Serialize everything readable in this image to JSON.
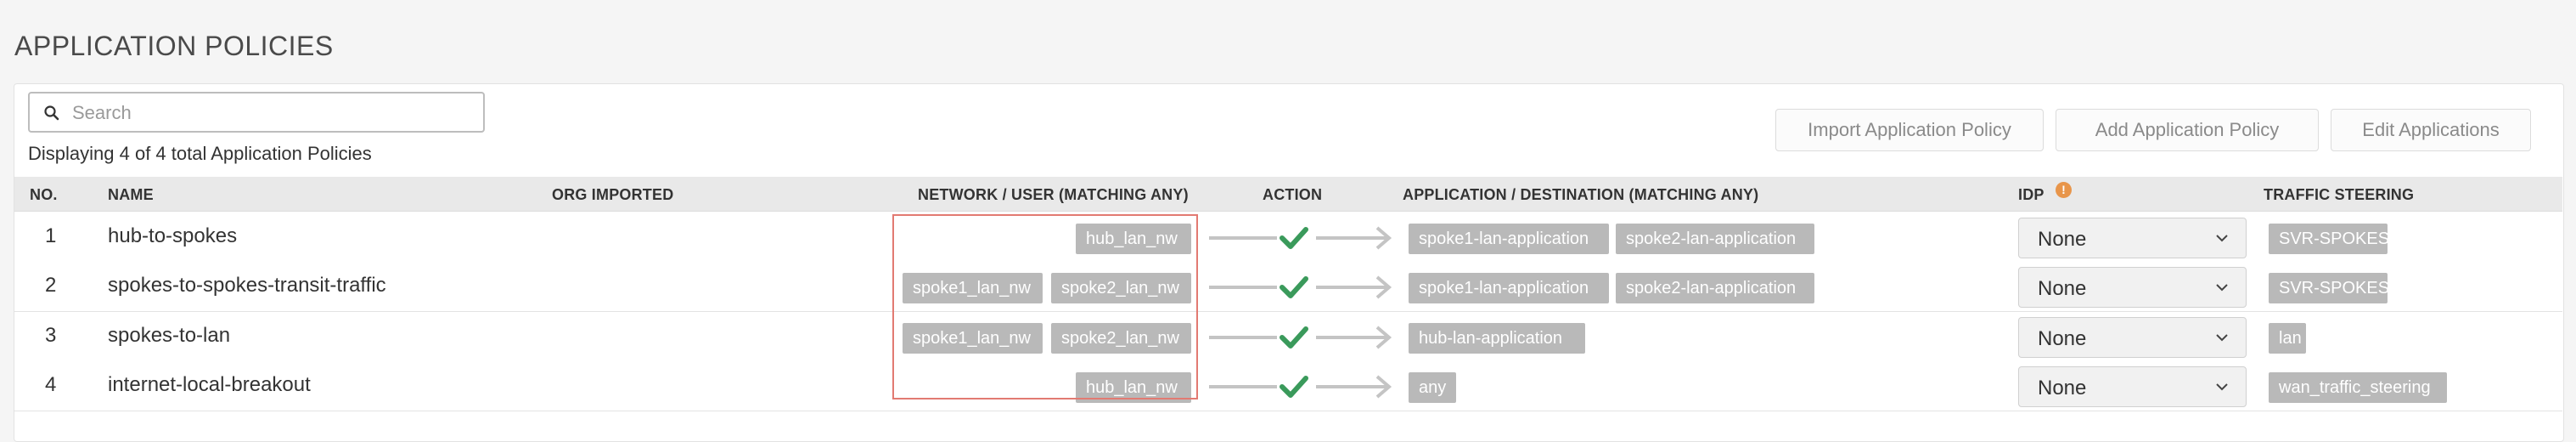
{
  "page": {
    "title": "APPLICATION POLICIES"
  },
  "search": {
    "placeholder": "Search",
    "value": ""
  },
  "summary": "Displaying 4 of 4 total Application Policies",
  "buttons": {
    "import": "Import Application Policy",
    "add": "Add Application Policy",
    "edit": "Edit Applications"
  },
  "columns": {
    "no": "NO.",
    "name": "NAME",
    "org_imported": "ORG IMPORTED",
    "network": "NETWORK / USER (MATCHING ANY)",
    "action": "ACTION",
    "application": "APPLICATION / DESTINATION (MATCHING ANY)",
    "idp": "IDP",
    "traffic": "TRAFFIC STEERING"
  },
  "idp_info_glyph": "!",
  "colors": {
    "accent_check": "#3a9a5b",
    "tag_bg": "#b9b9b9",
    "highlight_border": "#e27a72",
    "info_badge": "#e8954a"
  },
  "rows": [
    {
      "no": "1",
      "name": "hub-to-spokes",
      "org_imported": "",
      "networks": [
        "hub_lan_nw"
      ],
      "action": "allow",
      "applications": [
        "spoke1-lan-application",
        "spoke2-lan-application"
      ],
      "idp": "None",
      "traffic_steering": "SVR-SPOKES"
    },
    {
      "no": "2",
      "name": "spokes-to-spokes-transit-traffic",
      "org_imported": "",
      "networks": [
        "spoke1_lan_nw",
        "spoke2_lan_nw"
      ],
      "action": "allow",
      "applications": [
        "spoke1-lan-application",
        "spoke2-lan-application"
      ],
      "idp": "None",
      "traffic_steering": "SVR-SPOKES"
    },
    {
      "no": "3",
      "name": "spokes-to-lan",
      "org_imported": "",
      "networks": [
        "spoke1_lan_nw",
        "spoke2_lan_nw"
      ],
      "action": "allow",
      "applications": [
        "hub-lan-application"
      ],
      "idp": "None",
      "traffic_steering": "lan"
    },
    {
      "no": "4",
      "name": "internet-local-breakout",
      "org_imported": "",
      "networks": [
        "hub_lan_nw"
      ],
      "action": "allow",
      "applications": [
        "any"
      ],
      "idp": "None",
      "traffic_steering": "wan_traffic_steering"
    }
  ]
}
